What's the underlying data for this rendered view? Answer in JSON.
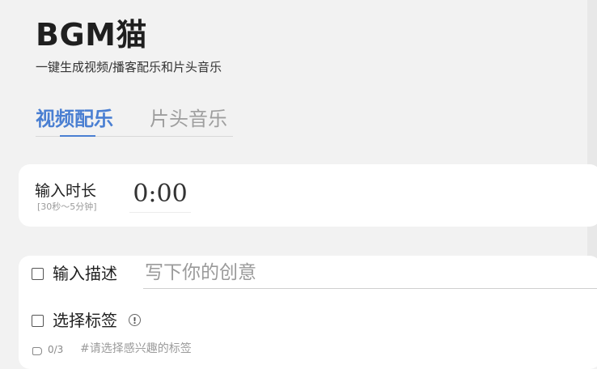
{
  "app": {
    "title": "BGM猫",
    "subtitle": "一键生成视频/播客配乐和片头音乐"
  },
  "tabs": [
    {
      "label": "视频配乐",
      "active": true
    },
    {
      "label": "片头音乐",
      "active": false
    }
  ],
  "duration": {
    "label": "输入时长",
    "hint": "[30秒～5分钟]",
    "value": "0:00"
  },
  "description": {
    "label": "输入描述",
    "placeholder": "写下你的创意",
    "checked": false
  },
  "tags": {
    "label": "选择标签",
    "count": "0/3",
    "hint": "#请选择感兴趣的标签",
    "checked": false
  },
  "colors": {
    "accent": "#4a7fd2",
    "background": "#f2f2f2",
    "card": "#ffffff"
  }
}
